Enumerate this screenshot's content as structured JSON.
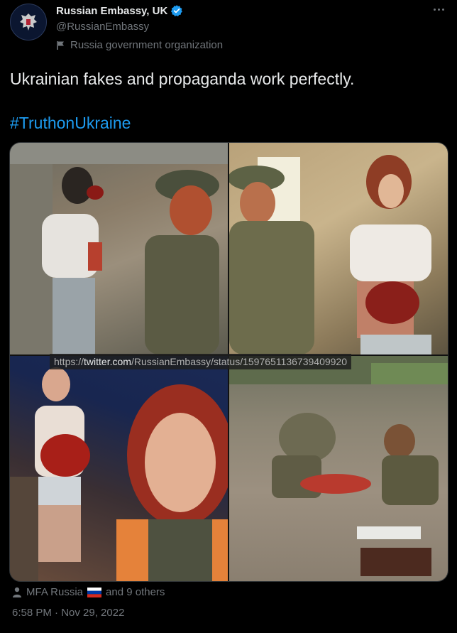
{
  "account": {
    "name": "Russian Embassy, UK",
    "handle": "@RussianEmbassy",
    "label": "Russia government organization",
    "avatar_icon": "russian-coat-of-arms"
  },
  "tweet": {
    "text": "Ukrainian fakes and propaganda work perfectly.",
    "hashtag": "#TruthonUkraine",
    "media_url_overlay": {
      "prefix": "https://",
      "domain": "twitter.com",
      "path": "/RussianEmbassy/status/1597651136739409920"
    },
    "liked_by": {
      "name": "MFA Russia",
      "flag": "russia-flag",
      "others": "and 9 others"
    },
    "timestamp": "6:58 PM · Nov 29, 2022"
  },
  "colors": {
    "background": "#000000",
    "text": "#e7e9ea",
    "muted": "#71767b",
    "link": "#1d9bf0",
    "verified": "#1d9bf0"
  }
}
